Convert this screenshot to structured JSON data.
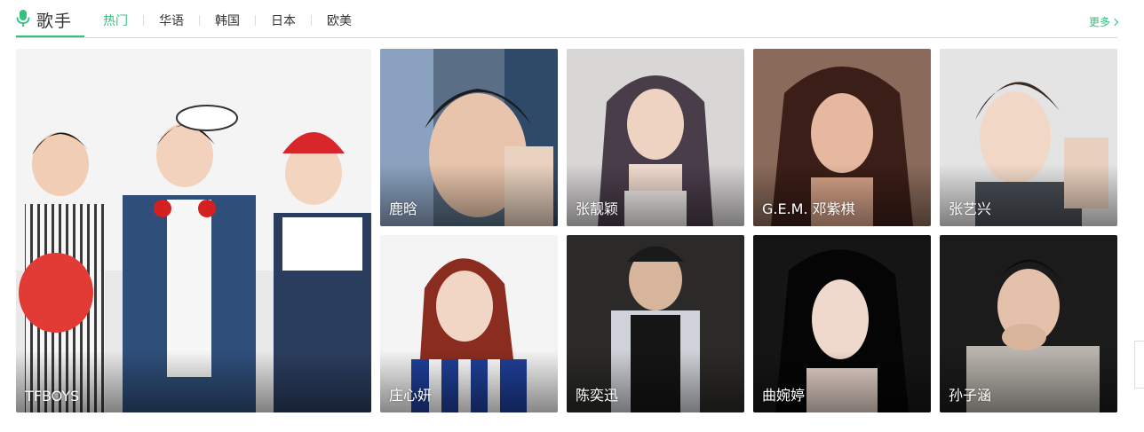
{
  "header": {
    "title": "歌手",
    "tabs": [
      {
        "label": "热门",
        "active": true
      },
      {
        "label": "华语",
        "active": false
      },
      {
        "label": "韩国",
        "active": false
      },
      {
        "label": "日本",
        "active": false
      },
      {
        "label": "欧美",
        "active": false
      }
    ],
    "more_label": "更多"
  },
  "singers": {
    "featured": {
      "name": "TFBOYS"
    },
    "items": [
      {
        "name": "鹿晗"
      },
      {
        "name": "张靓颖"
      },
      {
        "name": "G.E.M. 邓紫棋"
      },
      {
        "name": "张艺兴"
      },
      {
        "name": "庄心妍"
      },
      {
        "name": "陈奕迅"
      },
      {
        "name": "曲婉婷"
      },
      {
        "name": "孙子涵"
      }
    ]
  },
  "colors": {
    "accent": "#31c27c",
    "divider": "#d6d6d6",
    "text": "#333333"
  }
}
